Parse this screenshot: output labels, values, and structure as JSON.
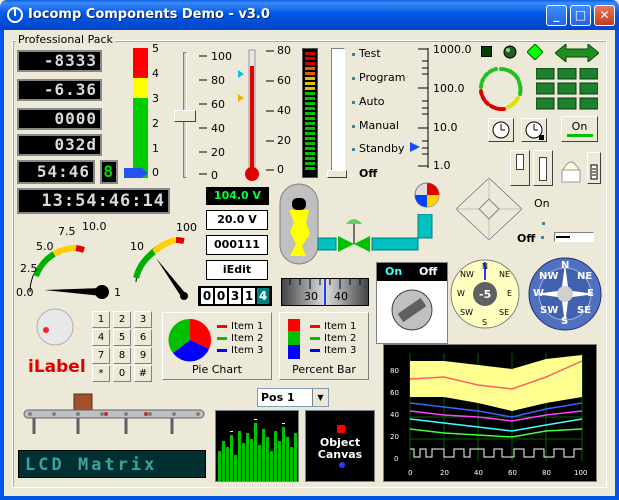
{
  "window": {
    "title": "Iocomp Components Demo - v3.0",
    "buttons": {
      "minimize": "_",
      "maximize": "□",
      "close": "✕"
    }
  },
  "groupbox": {
    "label": "Professional Pack"
  },
  "lcd_displays": [
    {
      "value": "-8333"
    },
    {
      "value": "-6.36"
    },
    {
      "value": "0000"
    },
    {
      "value": "032d"
    },
    {
      "value": "54:46"
    },
    {
      "value": "13:54:46:14"
    }
  ],
  "single_digit": "8",
  "bar_scale_labels": [
    "5",
    "4",
    "3",
    "2",
    "1",
    "0"
  ],
  "slider_scale_labels": [
    "100",
    "80",
    "60",
    "40",
    "20",
    "0"
  ],
  "thermo_scale_labels": [
    "80",
    "60",
    "40",
    "20",
    "0"
  ],
  "switch_positions": [
    "Test",
    "Program",
    "Auto",
    "Manual",
    "Standby",
    "Off"
  ],
  "log_scale_labels": [
    "1000.0",
    "100.0",
    "10.0",
    "1.0"
  ],
  "voltage_led": "104.0 V",
  "edit_values": {
    "voltage": "20.0 V",
    "binary": "000111",
    "iedit": "iEdit"
  },
  "odometer": [
    "0",
    "0",
    "3",
    "1",
    "4"
  ],
  "slider_ruler_labels": [
    "30",
    "40"
  ],
  "gauge_left": {
    "labels": [
      "0.0",
      "2.5",
      "5.0",
      "7.5",
      "10.0"
    ],
    "value_label": "1"
  },
  "gauge_right": {
    "labels": [
      "10",
      "100"
    ]
  },
  "toggle_labels": {
    "on": "On",
    "off": "Off"
  },
  "on_button": "On",
  "rotary_switch": {
    "on": "On",
    "off": "Off"
  },
  "compass_small": {
    "value": "-5",
    "dirs": [
      "N",
      "NE",
      "E",
      "SE",
      "S",
      "SW",
      "W",
      "NW"
    ]
  },
  "compass_large": {
    "dirs": [
      "N",
      "NE",
      "E",
      "SE",
      "S",
      "SW",
      "W",
      "NW"
    ]
  },
  "keypad": [
    "1",
    "2",
    "3",
    "4",
    "5",
    "6",
    "7",
    "8",
    "9",
    "*",
    "0",
    "#"
  ],
  "ilabel": "iLabel",
  "pie_chart": {
    "title": "Pie Chart",
    "items": [
      {
        "label": "Item 1",
        "color": "#FF0000"
      },
      {
        "label": "Item 2",
        "color": "#00C000"
      },
      {
        "label": "Item 3",
        "color": "#0000FF"
      }
    ]
  },
  "percent_bar": {
    "title": "Percent Bar",
    "items": [
      {
        "label": "Item 1",
        "color": "#FF0000"
      },
      {
        "label": "Item 2",
        "color": "#00C000"
      },
      {
        "label": "Item 3",
        "color": "#0000FF"
      }
    ]
  },
  "dropdown": {
    "selected": "Pos 1"
  },
  "lcd_matrix": "LCD Matrix",
  "object_canvas": "Object\nCanvas",
  "plot": {
    "y_ticks": [
      "80",
      "60",
      "40",
      "20",
      "0"
    ],
    "x_ticks": [
      "0",
      "20",
      "40",
      "60",
      "80",
      "100"
    ]
  },
  "colors": {
    "titlebar": "#0055E5",
    "face": "#ECE9D8",
    "lcd_bg": "#000000",
    "led_green": "#00FF00"
  }
}
